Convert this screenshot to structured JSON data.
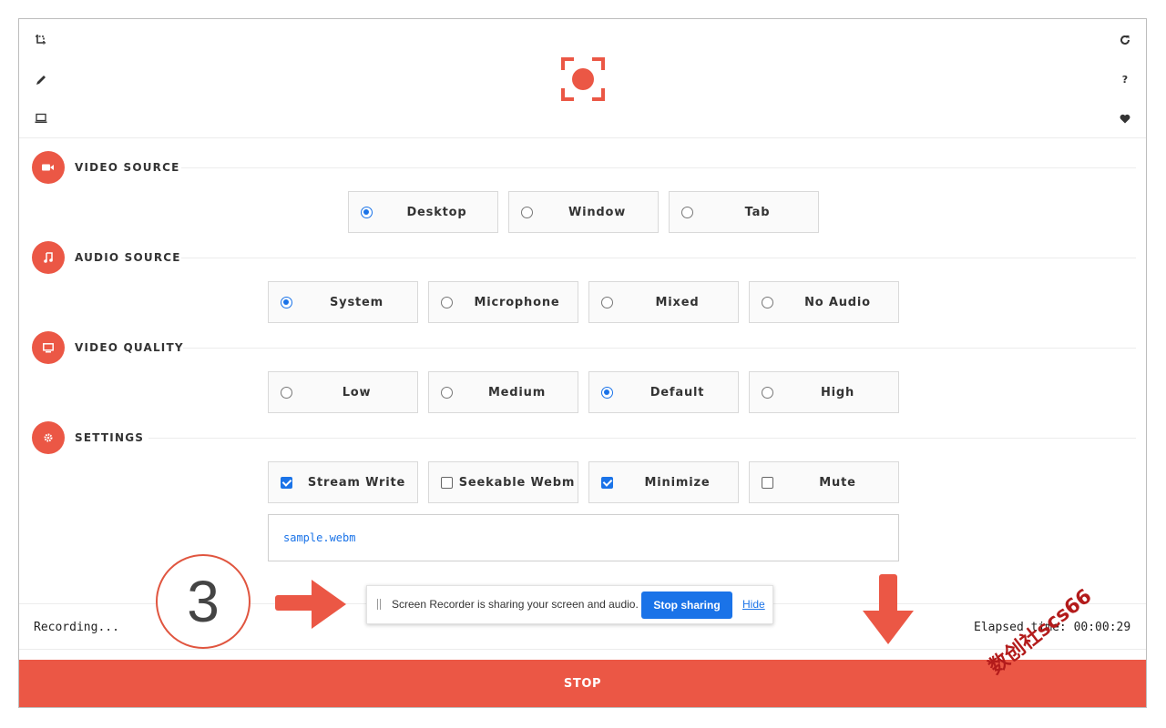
{
  "sidebar_left": {
    "icons": [
      "crop-icon",
      "pencil-icon",
      "laptop-icon"
    ]
  },
  "sidebar_right": {
    "icons": [
      "refresh-icon",
      "help-icon",
      "heart-icon"
    ]
  },
  "sections": {
    "video_source": {
      "title": "VIDEO SOURCE",
      "options": [
        {
          "label": "Desktop",
          "selected": true
        },
        {
          "label": "Window",
          "selected": false
        },
        {
          "label": "Tab",
          "selected": false
        }
      ]
    },
    "audio_source": {
      "title": "AUDIO SOURCE",
      "options": [
        {
          "label": "System",
          "selected": true
        },
        {
          "label": "Microphone",
          "selected": false
        },
        {
          "label": "Mixed",
          "selected": false
        },
        {
          "label": "No Audio",
          "selected": false
        }
      ]
    },
    "video_quality": {
      "title": "VIDEO QUALITY",
      "options": [
        {
          "label": "Low",
          "selected": false
        },
        {
          "label": "Medium",
          "selected": false
        },
        {
          "label": "Default",
          "selected": true
        },
        {
          "label": "High",
          "selected": false
        }
      ]
    },
    "settings": {
      "title": "SETTINGS",
      "options": [
        {
          "label": "Stream Write",
          "checked": true
        },
        {
          "label": "Seekable Webm",
          "checked": false
        },
        {
          "label": "Minimize",
          "checked": true
        },
        {
          "label": "Mute",
          "checked": false
        }
      ],
      "filename": "sample.webm"
    }
  },
  "status": {
    "recording": "Recording...",
    "elapsed_label": "Elapsed time:",
    "elapsed_value": "00:00:29"
  },
  "stop_label": "STOP",
  "share_bar": {
    "message": "Screen Recorder is sharing your screen and audio.",
    "stop_label": "Stop sharing",
    "hide_label": "Hide"
  },
  "annotation": {
    "step_number": "3"
  },
  "watermark": "数创社scs66",
  "colors": {
    "accent": "#eb5745",
    "blue": "#1a73e8"
  }
}
